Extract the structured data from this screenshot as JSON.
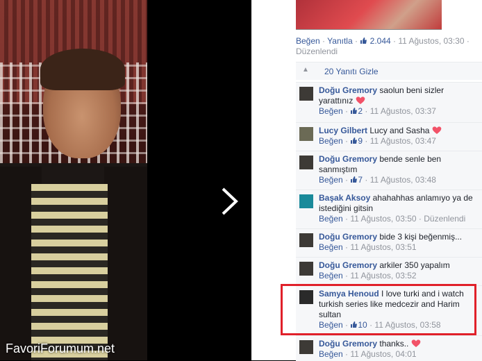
{
  "watermark": "FavoriForumum.net",
  "parent_comment": {
    "like": "Beğen",
    "reply": "Yanıtla",
    "like_count": "2.044",
    "timestamp": "11 Ağustos, 03:30",
    "edited": "Düzenlendi"
  },
  "hide_replies": "20 Yanıtı Gizle",
  "replies": [
    {
      "author": "Doğu Gremory",
      "text": "saolun beni sizler yarattınız",
      "heart": true,
      "like": "Beğen",
      "likes": "2",
      "time": "11 Ağustos, 03:37",
      "edited": ""
    },
    {
      "author": "Lucy Gilbert",
      "text": "Lucy and Sasha",
      "heart": true,
      "like": "Beğen",
      "likes": "9",
      "time": "11 Ağustos, 03:47",
      "edited": ""
    },
    {
      "author": "Doğu Gremory",
      "text": "bende senle ben sanmıştım",
      "heart": false,
      "like": "Beğen",
      "likes": "7",
      "time": "11 Ağustos, 03:48",
      "edited": ""
    },
    {
      "author": "Başak Aksoy",
      "text": "ahahahhas anlamıyo ya de istediğini gitsin",
      "heart": false,
      "like": "Beğen",
      "likes": "",
      "time": "11 Ağustos, 03:50",
      "edited": "Düzenlendi"
    },
    {
      "author": "Doğu Gremory",
      "text": "bide 3 kişi beğenmiş...",
      "heart": false,
      "like": "Beğen",
      "likes": "",
      "time": "11 Ağustos, 03:51",
      "edited": ""
    },
    {
      "author": "Doğu Gremory",
      "text": "arkiler 350 yapalım",
      "heart": false,
      "like": "Beğen",
      "likes": "",
      "time": "11 Ağustos, 03:52",
      "edited": ""
    },
    {
      "author": "Samya Henoud",
      "text": "I love turki and i watch turkish series like medcezir and Harim sultan",
      "heart": false,
      "like": "Beğen",
      "likes": "10",
      "time": "11 Ağustos, 03:58",
      "edited": ""
    },
    {
      "author": "Doğu Gremory",
      "text": "thanks..",
      "heart": true,
      "like": "Beğen",
      "likes": "",
      "time": "11 Ağustos, 04:01",
      "edited": ""
    }
  ],
  "colors": {
    "link": "#365899",
    "meta": "#90949c",
    "highlight": "#e0202a",
    "heart": "#f25268"
  }
}
